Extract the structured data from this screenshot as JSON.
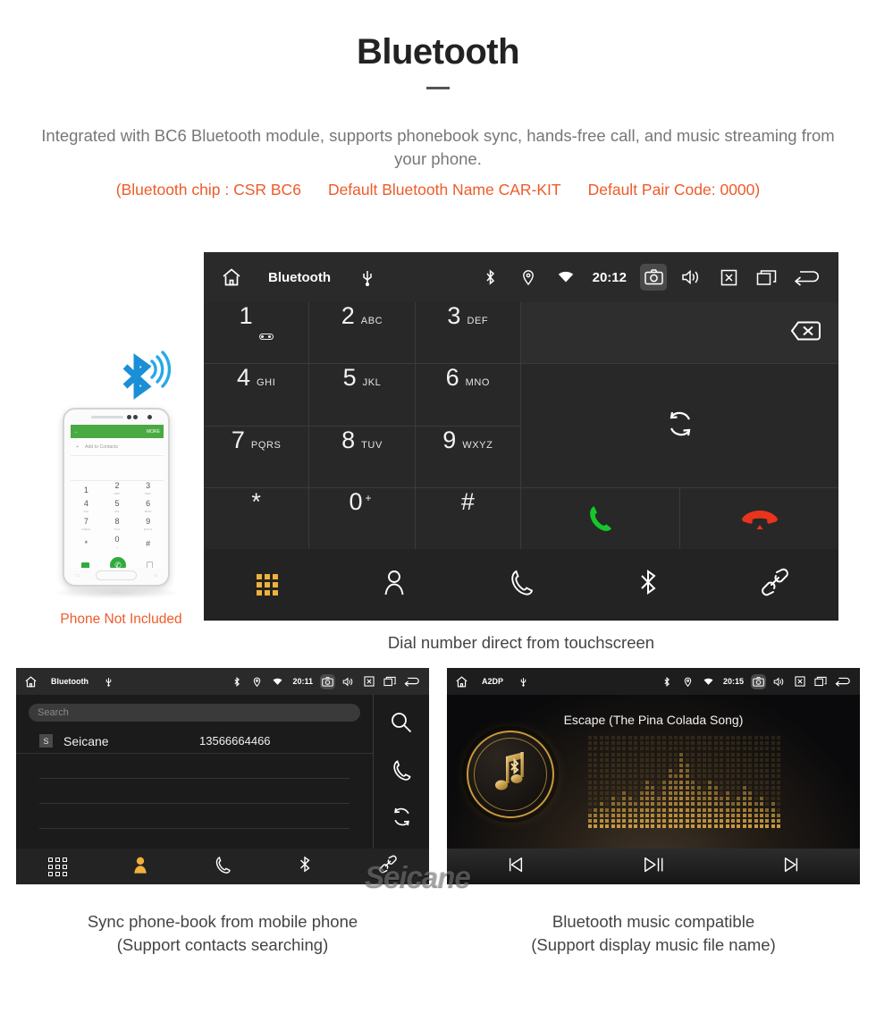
{
  "header": {
    "title": "Bluetooth",
    "intro": "Integrated with BC6 Bluetooth module, supports phonebook sync, hands-free call, and music streaming from your phone.",
    "spec_chip": "(Bluetooth chip : CSR BC6",
    "spec_name": "Default Bluetooth Name CAR-KIT",
    "spec_pair": "Default Pair Code: 0000)",
    "accent_color": "#ee5b29",
    "body_color": "#777777"
  },
  "phone_illustration": {
    "caption": "Phone Not Included",
    "screen": {
      "back_label": "←",
      "more_label": "MORE",
      "add_contacts": "Add to Contacts",
      "plus": "+",
      "keys": [
        {
          "num": "1",
          "sub": ""
        },
        {
          "num": "2",
          "sub": "ABC"
        },
        {
          "num": "3",
          "sub": "DEF"
        },
        {
          "num": "4",
          "sub": "GHI"
        },
        {
          "num": "5",
          "sub": "JKL"
        },
        {
          "num": "6",
          "sub": "MNO"
        },
        {
          "num": "7",
          "sub": "PQRS"
        },
        {
          "num": "8",
          "sub": "TUV"
        },
        {
          "num": "9",
          "sub": "WXYZ"
        },
        {
          "num": "*",
          "sub": ""
        },
        {
          "num": "0",
          "sub": "+"
        },
        {
          "num": "#",
          "sub": ""
        }
      ]
    }
  },
  "dialer": {
    "statusbar": {
      "title": "Bluetooth",
      "time": "20:12",
      "icons": [
        "home-icon",
        "usb-icon",
        "bluetooth-icon",
        "location-icon",
        "wifi-icon",
        "camera-icon",
        "volume-icon",
        "close-icon",
        "recents-icon",
        "back-icon"
      ]
    },
    "keys": [
      {
        "num": "1",
        "sub": "voicemail"
      },
      {
        "num": "2",
        "sub": "ABC"
      },
      {
        "num": "3",
        "sub": "DEF"
      },
      {
        "num": "4",
        "sub": "GHI"
      },
      {
        "num": "5",
        "sub": "JKL"
      },
      {
        "num": "6",
        "sub": "MNO"
      },
      {
        "num": "7",
        "sub": "PQRS"
      },
      {
        "num": "8",
        "sub": "TUV"
      },
      {
        "num": "9",
        "sub": "WXYZ"
      },
      {
        "num": "*",
        "sub": ""
      },
      {
        "num": "0",
        "sub": "+"
      },
      {
        "num": "#",
        "sub": ""
      }
    ],
    "actions": {
      "backspace": "backspace-icon",
      "sync": "sync-icon",
      "call": "call-icon",
      "hangup": "hangup-icon",
      "call_color": "#15c629",
      "hangup_color": "#e8341c"
    },
    "tabs": [
      {
        "name": "keypad",
        "icon": "keypad-icon",
        "active": true
      },
      {
        "name": "contacts",
        "icon": "contact-icon",
        "active": false
      },
      {
        "name": "call-log",
        "icon": "phone-icon",
        "active": false
      },
      {
        "name": "bluetooth",
        "icon": "bluetooth-icon",
        "active": false
      },
      {
        "name": "link",
        "icon": "link-icon",
        "active": false
      }
    ],
    "active_color": "#f0b03c",
    "caption": "Dial number direct from touchscreen"
  },
  "phonebook": {
    "statusbar": {
      "title": "Bluetooth",
      "time": "20:11"
    },
    "search_placeholder": "Search",
    "contacts": [
      {
        "badge": "S",
        "name": "Seicane",
        "number": "13566664466"
      }
    ],
    "rail": [
      "search-icon",
      "phone-icon",
      "sync-icon"
    ],
    "tabs": [
      {
        "name": "keypad",
        "icon": "keypad-icon",
        "active": false
      },
      {
        "name": "contacts",
        "icon": "contact-icon",
        "active": true
      },
      {
        "name": "call-log",
        "icon": "phone-icon",
        "active": false
      },
      {
        "name": "bluetooth",
        "icon": "bluetooth-icon",
        "active": false
      },
      {
        "name": "link",
        "icon": "link-icon",
        "active": false
      }
    ],
    "caption_line1": "Sync phone-book from mobile phone",
    "caption_line2": "(Support contacts searching)"
  },
  "music": {
    "statusbar": {
      "title": "A2DP",
      "time": "20:15"
    },
    "song_title": "Escape (The Pina Colada Song)",
    "accent_color": "#c79a3d",
    "controls": [
      {
        "name": "previous",
        "icon": "skip-previous-icon"
      },
      {
        "name": "play-pause",
        "icon": "play-pause-icon"
      },
      {
        "name": "next",
        "icon": "skip-next-icon"
      }
    ],
    "caption_line1": "Bluetooth music compatible",
    "caption_line2": "(Support display music file name)"
  },
  "watermark": {
    "text": "Seicane"
  }
}
